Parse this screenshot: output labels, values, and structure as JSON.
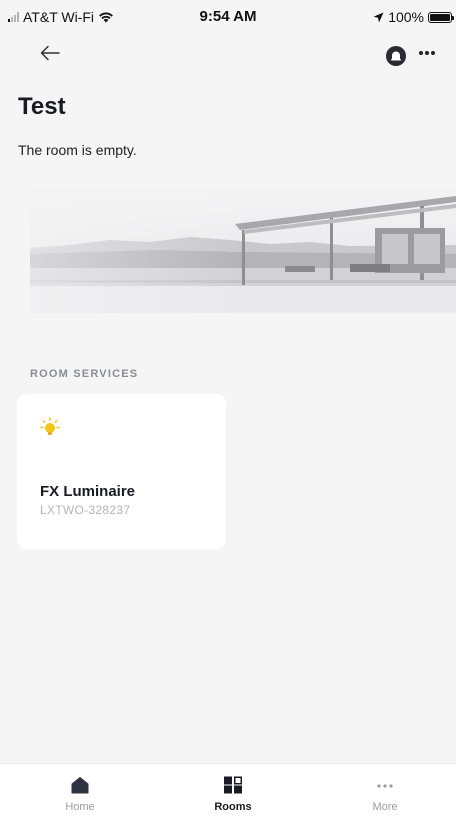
{
  "status_bar": {
    "carrier": "AT&T Wi-Fi",
    "time": "9:54 AM",
    "battery": "100%"
  },
  "header": {
    "back_icon": "arrow-left-icon",
    "bell_icon": "bell-icon",
    "more_icon": "more-horizontal-icon"
  },
  "room": {
    "title": "Test",
    "status": "The room is empty."
  },
  "services": {
    "section_label": "ROOM SERVICES",
    "items": [
      {
        "name": "FX Luminaire",
        "id": "LXTWO-328237",
        "icon": "lightbulb-icon",
        "icon_color": "#f5c518"
      }
    ]
  },
  "tab_bar": {
    "items": [
      {
        "label": "Home",
        "icon": "home-icon",
        "active": false
      },
      {
        "label": "Rooms",
        "icon": "grid-icon",
        "active": true
      },
      {
        "label": "More",
        "icon": "more-horizontal-icon",
        "active": false
      }
    ]
  },
  "colors": {
    "background": "#f5f5f5",
    "card": "#ffffff",
    "accent_yellow": "#f5c518",
    "muted": "#8a8d97"
  }
}
